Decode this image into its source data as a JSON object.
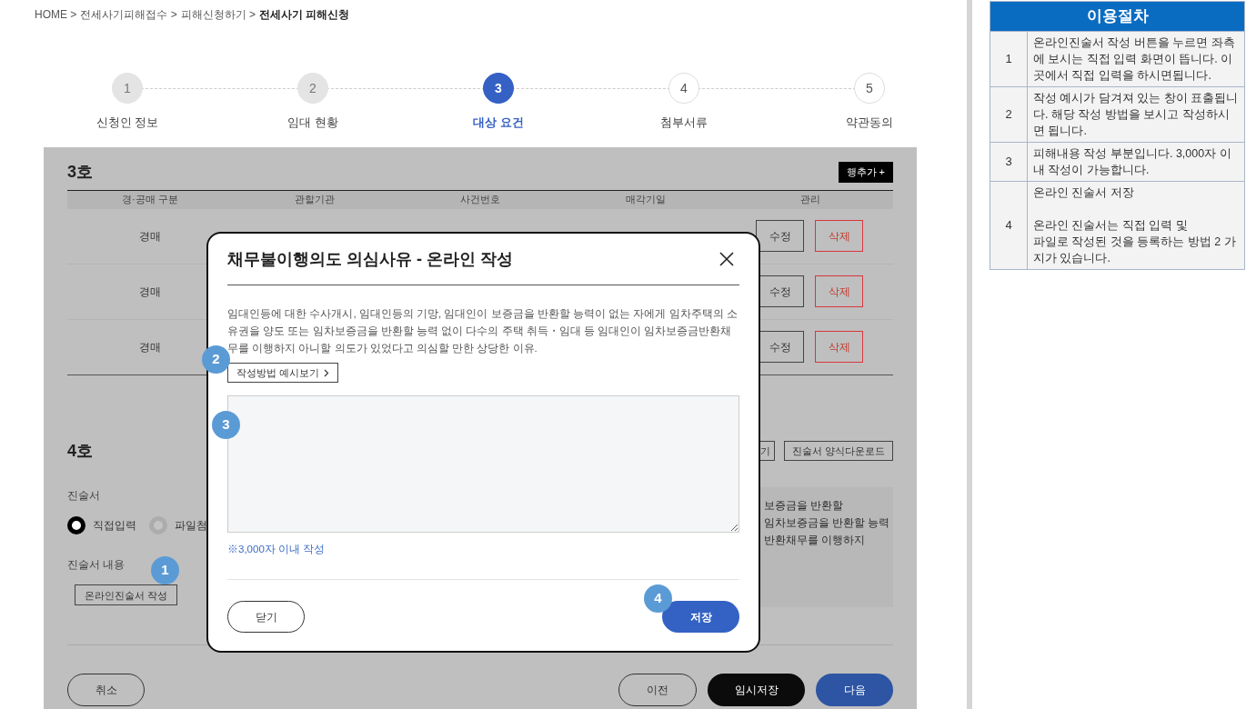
{
  "breadcrumb": [
    {
      "label": "HOME >",
      "current": false
    },
    {
      "label": "전세사기피해접수 >",
      "current": false
    },
    {
      "label": "피해신청하기 >",
      "current": false
    },
    {
      "label": "전세사기 피해신청",
      "current": true
    }
  ],
  "steps": [
    {
      "number": "1",
      "label": "신청인 정보",
      "selected": false,
      "completed": true
    },
    {
      "number": "2",
      "label": "임대 현황",
      "selected": false,
      "completed": true
    },
    {
      "number": "3",
      "label": "대상 요건",
      "selected": true,
      "completed": false
    },
    {
      "number": "4",
      "label": "첨부서류",
      "selected": false,
      "completed": false
    },
    {
      "number": "5",
      "label": "약관동의",
      "selected": false,
      "completed": false
    }
  ],
  "section3": {
    "title": "3호",
    "add_button": "행추가 +",
    "columns": [
      "경·공매 구분",
      "관할기관",
      "사건번호",
      "매각기일",
      "관리"
    ],
    "rows": [
      {
        "type": "경매",
        "edit": "수정",
        "delete": "삭제"
      },
      {
        "type": "경매",
        "edit": "수정",
        "delete": "삭제"
      },
      {
        "type": "경매",
        "edit": "수정",
        "delete": "삭제"
      }
    ]
  },
  "section4": {
    "title": "4호",
    "buttons": [
      "기",
      "진술서 양식다운로드"
    ],
    "statement_label": "진술서",
    "radios": [
      {
        "label": "직접입력",
        "selected": true
      },
      {
        "label": "파일첨",
        "selected": false
      }
    ],
    "content_label": "진술서 내용",
    "write_button": "온라인진술서 작성",
    "preview_lines": [
      "보증금을 반환할",
      "임차보증금을 반환할 능력",
      "반환채무를 이행하지"
    ]
  },
  "footer": {
    "cancel": "취소",
    "prev": "이전",
    "temp_save": "임시저장",
    "next": "다음"
  },
  "modal": {
    "title": "채무불이행의도 의심사유 - 온라인 작성",
    "description": "임대인등에 대한 수사개시, 임대인등의 기망, 임대인이 보증금을 반환할 능력이 없는 자에게 임차주택의 소유권을 양도 또는 임차보증금을 반환할 능력 없이 다수의 주택 취득・임대 등 임대인이 임차보증금반환채무를 이행하지 아니할 의도가 있었다고 의심할 만한 상당한 이유.",
    "example_button": "작성방법 예시보기",
    "note": "※3,000자 이내 작성",
    "close_button": "닫기",
    "save_button": "저장"
  },
  "markers": [
    {
      "number": "1"
    },
    {
      "number": "2"
    },
    {
      "number": "3"
    },
    {
      "number": "4"
    }
  ],
  "guide": {
    "title": "이용절차",
    "rows": [
      {
        "number": "1",
        "text": "온라인진술서 작성 버튼을 누르면 좌측에 보시는 직접 입력 화면이 뜹니다. 이 곳에서 직접 입력을 하시면됩니다."
      },
      {
        "number": "2",
        "text": "작성 예시가 담겨져 있는 창이 표출됩니다. 해당 작성 방법을 보시고 작성하시면 됩니다."
      },
      {
        "number": "3",
        "text": "피해내용 작성 부분입니다. 3,000자 이내 작성이 가능합니다."
      },
      {
        "number": "4",
        "text": "온라인 진술서 저장\n\n온라인 진술서는 직접 입력 및\n파일로 작성된 것을 등록하는 방법 2 가지가 있습니다."
      }
    ]
  }
}
